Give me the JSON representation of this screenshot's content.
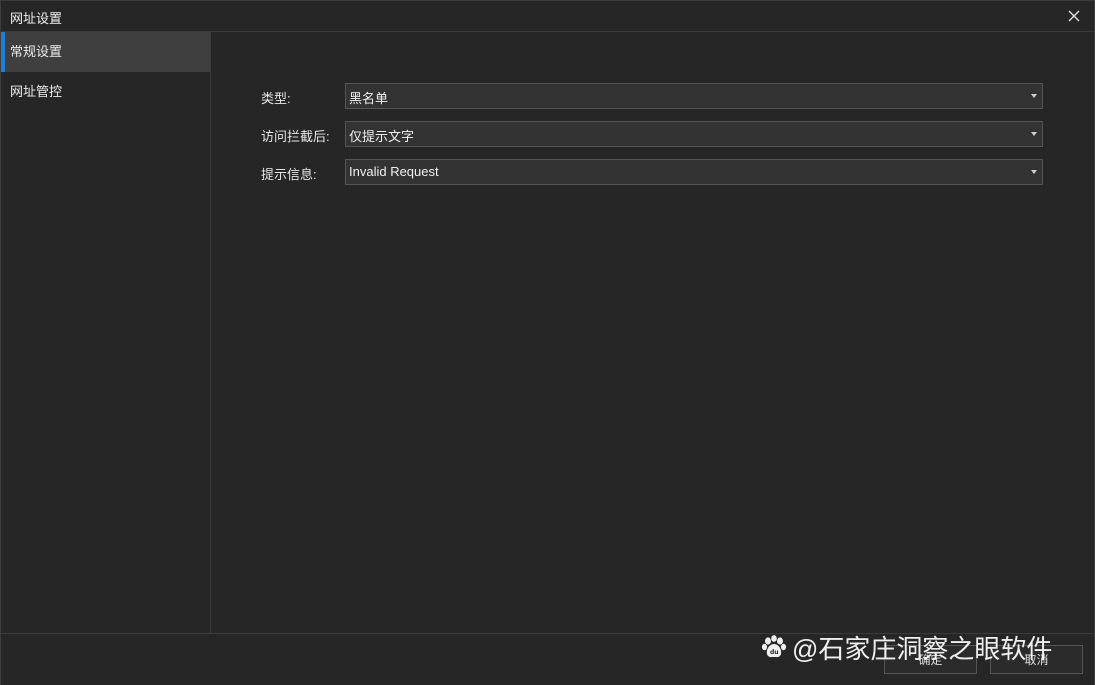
{
  "window": {
    "title": "网址设置"
  },
  "sidebar": {
    "items": [
      {
        "label": "常规设置",
        "active": true
      },
      {
        "label": "网址管控",
        "active": false
      }
    ]
  },
  "form": {
    "type": {
      "label": "类型:",
      "value": "黑名单"
    },
    "after_block": {
      "label": "访问拦截后:",
      "value": "仅提示文字"
    },
    "message": {
      "label": "提示信息:",
      "value": "Invalid Request"
    }
  },
  "footer": {
    "ok_label": "确定",
    "cancel_label": "取消"
  },
  "watermark": {
    "text": "@石家庄洞察之眼软件"
  },
  "colors": {
    "accent": "#1e7fd8",
    "background": "#262626",
    "active_item": "#3f3f3f"
  }
}
